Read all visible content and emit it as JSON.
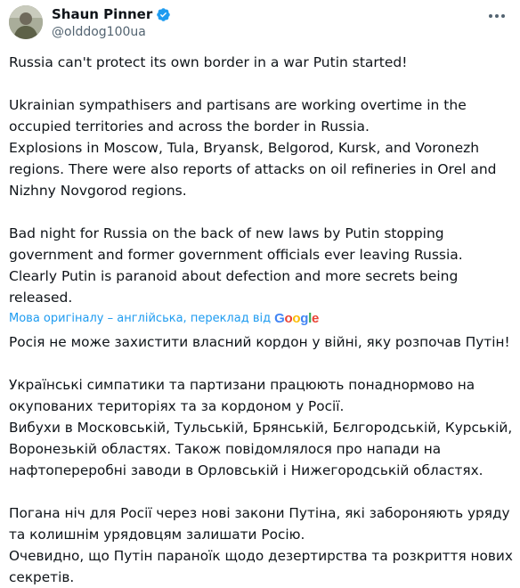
{
  "author": {
    "display_name": "Shaun Pinner",
    "handle": "@olddog100ua"
  },
  "icons": {
    "verified": "verified-badge-icon",
    "more": "more-options-icon"
  },
  "colors": {
    "verified_blue": "#1d9bf0",
    "text": "#0f1419",
    "secondary_text": "#536471"
  },
  "original_text": {
    "p1": "Russia can't protect its own border in a war Putin started!",
    "p2": "Ukrainian sympathisers and partisans are working overtime in the occupied territories and across the border in Russia.\nExplosions in  Moscow, Tula, Bryansk, Belgorod, Kursk, and Voronezh regions. There were also reports of attacks on oil refineries in Orel and Nizhny Novgorod regions.",
    "p3": "Bad night for Russia on the back of new laws by Putin stopping government and former government officials ever leaving Russia.\nClearly Putin is paranoid about defection and more secrets being released."
  },
  "translation_note": {
    "label": "Мова оригіналу – англійська, переклад від",
    "provider": "Google"
  },
  "translated_text": {
    "p1": "Росія не може захистити власний кордон у війні, яку розпочав Путін!",
    "p2": "Українські симпатики та партизани працюють понаднормово на окупованих територіях та за кордоном у Росії.\nВибухи в Московській, Тульській, Брянській, Бєлгородській, Курській, Воронезькій областях. Також повідомлялося про напади на нафтопереробні заводи в Орловській і Нижегородській областях.",
    "p3": "Погана ніч для Росії через нові закони Путіна, які забороняють уряду та колишнім урядовцям залишати Росію.\nОчевидно, що Путін параноїк щодо дезертирства та розкриття нових секретів."
  }
}
